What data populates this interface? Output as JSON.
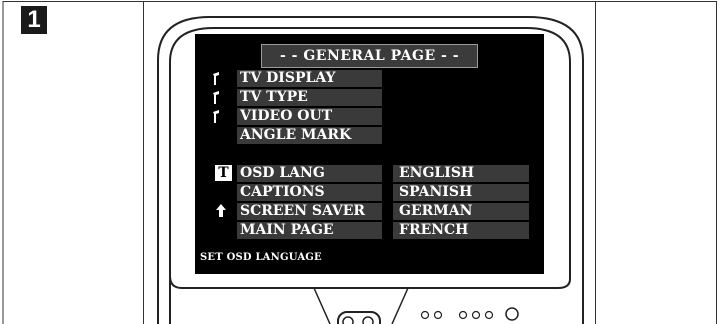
{
  "step": {
    "number": "1"
  },
  "osd": {
    "title": "- - GENERAL PAGE - -",
    "menu_items": [
      {
        "label": "TV DISPLAY",
        "icon": "folder-arrow-icon"
      },
      {
        "label": "TV TYPE",
        "icon": "folder-arrow-icon"
      },
      {
        "label": "VIDEO OUT",
        "icon": "folder-arrow-icon"
      },
      {
        "label": "ANGLE MARK",
        "icon": ""
      },
      {
        "label": "OSD LANG",
        "icon": "t-icon",
        "icon_text": "T"
      },
      {
        "label": "CAPTIONS",
        "icon": ""
      },
      {
        "label": "SCREEN SAVER",
        "icon": ""
      },
      {
        "label": "MAIN PAGE",
        "icon": "up-arrow-icon"
      }
    ],
    "language_options": [
      "ENGLISH",
      "SPANISH",
      "GERMAN",
      "FRENCH"
    ],
    "status_text": "SET OSD LANGUAGE"
  }
}
